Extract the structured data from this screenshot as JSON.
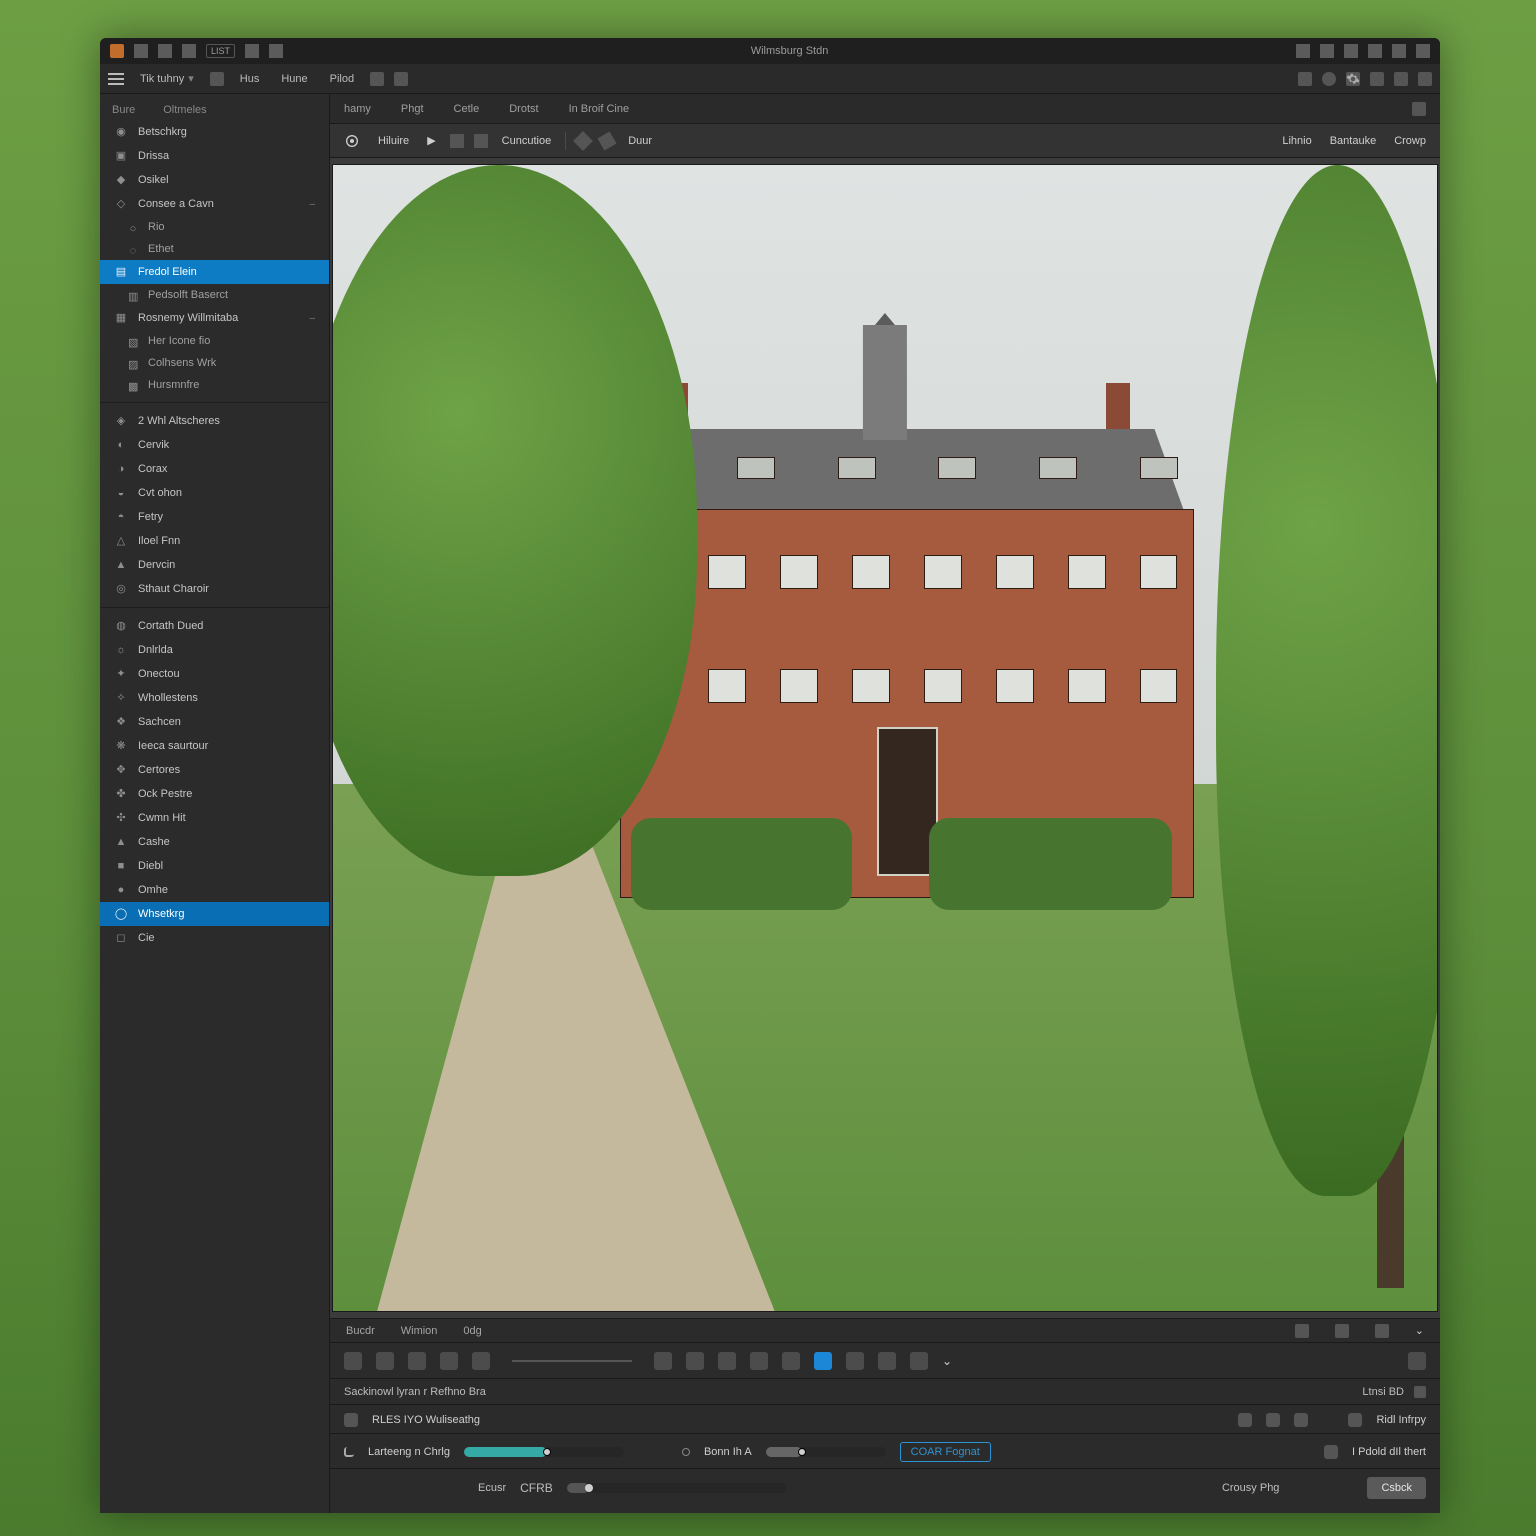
{
  "titlebar": {
    "title": "Wilmsburg Stdn",
    "left_badge": "LIST"
  },
  "menubar": {
    "items": [
      "Tik tuhny",
      "Hus",
      "Hune",
      "Pilod"
    ]
  },
  "sidebar": {
    "header1": "Bure",
    "header2": "Oltmeles",
    "items": [
      {
        "label": "Betschkrg"
      },
      {
        "label": "Drissa"
      },
      {
        "label": "Osikel"
      },
      {
        "label": "Consee a Cavn"
      },
      {
        "label": "Rio",
        "sub": true
      },
      {
        "label": "Ethet",
        "sub": true
      },
      {
        "label": "Fredol Elein",
        "active": true
      },
      {
        "label": "Pedsolft Baserct",
        "sub": true
      },
      {
        "label": "Rosnemy Willmitaba"
      },
      {
        "label": "Her Icone fio",
        "sub": true
      },
      {
        "label": "Colhsens Wrk",
        "sub": true
      },
      {
        "label": "Hursmnfre",
        "sub": true
      },
      {
        "label": "2 Whl Altscheres"
      },
      {
        "label": "Cervik"
      },
      {
        "label": "Corax"
      },
      {
        "label": "Cvt ohon"
      },
      {
        "label": "Fetry"
      },
      {
        "label": "Iloel Fnn"
      },
      {
        "label": "Dervcin"
      },
      {
        "label": "Sthaut Charoir"
      },
      {
        "label": "Cortath Dued"
      },
      {
        "label": "Dnlrlda"
      },
      {
        "label": "Onectou"
      },
      {
        "label": "Whollestens"
      },
      {
        "label": "Sachcen"
      },
      {
        "label": "Ieeca saurtour"
      },
      {
        "label": "Certores"
      },
      {
        "label": "Ock Pestre"
      },
      {
        "label": "Cwmn Hit"
      },
      {
        "label": "Cashe"
      },
      {
        "label": "Diebl"
      },
      {
        "label": "Omhe"
      },
      {
        "label": "Whsetkrg",
        "selected": true
      },
      {
        "label": "Cie"
      }
    ]
  },
  "tabs": [
    "hamy",
    "Phgt",
    "Cetle",
    "Drotst",
    "In Broif Cine"
  ],
  "toolbar": {
    "items": [
      "Hiluire",
      "Cuncutioe",
      "Duur",
      "Lihnio",
      "Bantauke",
      "Crowp"
    ]
  },
  "bottom": {
    "tabs": [
      "Bucdr",
      "Wimion",
      "0dg"
    ],
    "adjust_title": "Sackinowl lyran r Refhno Bra",
    "adjust_right": "Ltnsi BD",
    "line1_label": "RLES IYO Wuliseathg",
    "line1_end": "Ridl Infrpy",
    "slider1_label": "Larteeng n Chrlg",
    "mid_label": "Bonn Ih A",
    "chip": "COAR Fognat",
    "end_label": "I Pdold dIl thert",
    "focus_label": "Ecusr",
    "focus_value": "CFRB",
    "group_label": "Crousy Phg",
    "close_btn": "Csbck"
  }
}
